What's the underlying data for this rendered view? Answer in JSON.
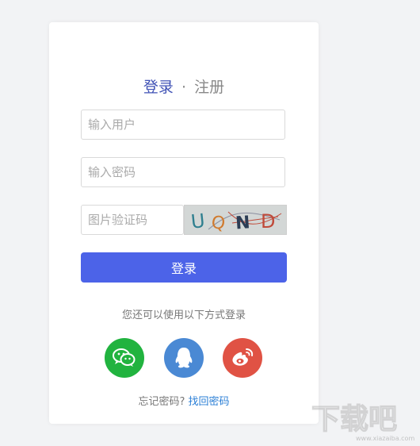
{
  "tabs": {
    "login": "登录",
    "separator": "·",
    "register": "注册"
  },
  "fields": {
    "username_placeholder": "输入用户",
    "password_placeholder": "输入密码",
    "captcha_placeholder": "图片验证码"
  },
  "captcha": {
    "chars": [
      "U",
      "Q",
      "N",
      "D"
    ],
    "colors": [
      "#2f7f8f",
      "#d07a2e",
      "#2c3d55",
      "#c04a3a"
    ]
  },
  "login_button": "登录",
  "alt_login_text": "您还可以使用以下方式登录",
  "social": {
    "wechat_color": "#21b33f",
    "qq_color": "#4a89d4",
    "weibo_color": "#e05244"
  },
  "forgot": {
    "text": "忘记密码?",
    "link": "找回密码"
  },
  "watermark": {
    "text": "下载吧",
    "url": "www.xiazaiba.com"
  }
}
